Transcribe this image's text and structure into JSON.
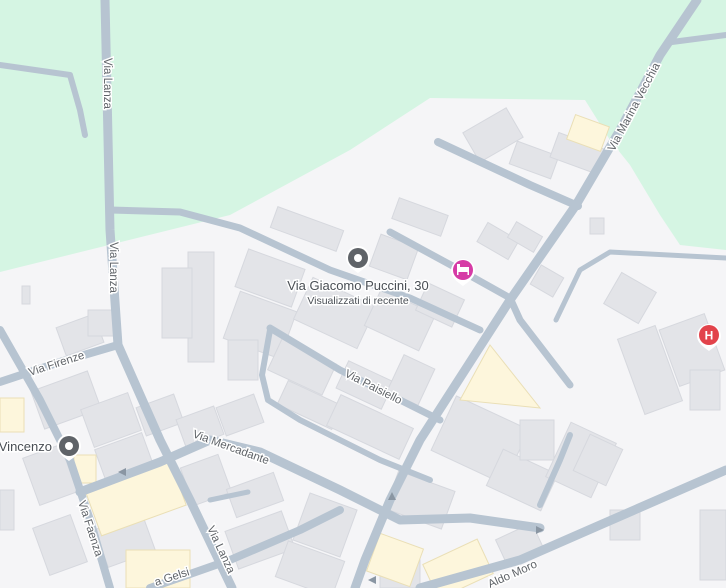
{
  "colors": {
    "land": "#f5f5f7",
    "park": "#d5f5e3",
    "road": "#b7c4d1",
    "building": "#e3e4e8",
    "building_edge": "#d6d8de",
    "highlight": "#fdf6dc",
    "hotel_pin": "#d63ba6",
    "hospital_pin": "#e2434b",
    "place_pin": "#5f6368"
  },
  "roads": {
    "lanza_top": "Via Lanza",
    "lanza_mid": "Via Lanza",
    "lanza_bottom": "Via Lanza",
    "marina_vecchia": "Via Marina Vecchia",
    "firenze": "Via Firenze",
    "paisiello": "Via Paisiello",
    "mercadante": "Via Mercadante",
    "faenza": "Via Faenza",
    "gelsi": "a Gelsi",
    "aldo_moro": "Aldo Moro"
  },
  "places": {
    "puccini": {
      "title": "Via Giacomo Puccini, 30",
      "subtitle": "Visualizzati di recente",
      "icon": "location-pin-icon"
    },
    "vincenzo": {
      "title": "Vincenzo",
      "icon": "location-pin-icon"
    },
    "hotel": {
      "icon": "hotel-bed-icon"
    },
    "hospital": {
      "label": "H",
      "icon": "hospital-icon"
    }
  }
}
